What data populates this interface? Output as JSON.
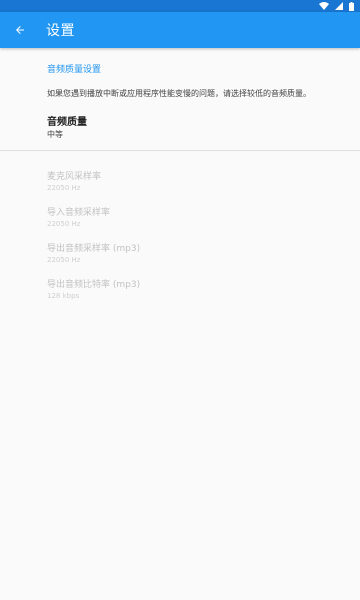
{
  "app_bar": {
    "title": "设置"
  },
  "section": {
    "header": "音频质量设置",
    "description": "如果您遇到播放中断或应用程序性能变慢的问题，请选择较低的音频质量。"
  },
  "audio_quality": {
    "title": "音频质量",
    "value": "中等"
  },
  "disabled_prefs": [
    {
      "title": "麦克风采样率",
      "value": "22050 Hz"
    },
    {
      "title": "导入音频采样率",
      "value": "22050 Hz"
    },
    {
      "title": "导出音频采样率 (mp3)",
      "value": "22050 Hz"
    },
    {
      "title": "导出音频比特率 (mp3)",
      "value": "128 kbps"
    }
  ],
  "colors": {
    "primary": "#2196f3",
    "primary_dark": "#1976d2",
    "disabled_text": "#c2c2c2"
  },
  "icons": [
    "wifi-icon",
    "battery-icon",
    "back-arrow-icon"
  ]
}
